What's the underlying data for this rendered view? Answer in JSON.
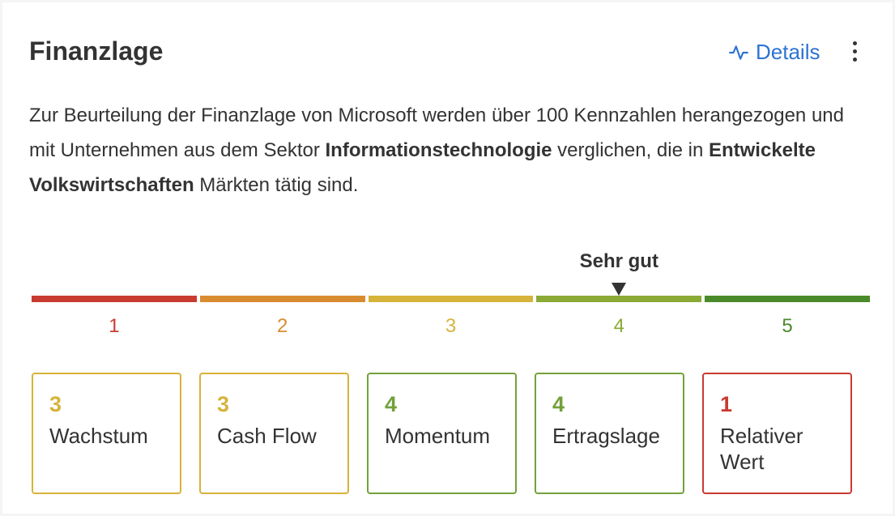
{
  "header": {
    "title": "Finanzlage",
    "details_label": "Details",
    "details_icon": "activity-icon",
    "more_icon": "more-vertical-icon"
  },
  "description": {
    "part1": "Zur Beurteilung der Finanzlage von Microsoft werden über 100 Kennzahlen herangezogen und mit Unternehmen aus dem Sektor ",
    "bold1": "Informationstechnologie",
    "part2": " verglichen, die in ",
    "bold2": "Entwickelte Volkswirtschaften",
    "part3": " Märkten tätig sind."
  },
  "scale": {
    "current_label": "Sehr gut",
    "current_value": 4,
    "levels": [
      {
        "value": "1",
        "color": "#c93a31"
      },
      {
        "value": "2",
        "color": "#d98b30"
      },
      {
        "value": "3",
        "color": "#d6b33b"
      },
      {
        "value": "4",
        "color": "#8aaa35"
      },
      {
        "value": "5",
        "color": "#4a8a2a"
      }
    ]
  },
  "categories": [
    {
      "score": "3",
      "name": "Wachstum",
      "color": "#d6b33b"
    },
    {
      "score": "3",
      "name": "Cash Flow",
      "color": "#d6b33b"
    },
    {
      "score": "4",
      "name": "Momentum",
      "color": "#72a13a"
    },
    {
      "score": "4",
      "name": "Ertragslage",
      "color": "#72a13a"
    },
    {
      "score": "1",
      "name": "Relativer Wert",
      "color": "#c93a31"
    }
  ]
}
